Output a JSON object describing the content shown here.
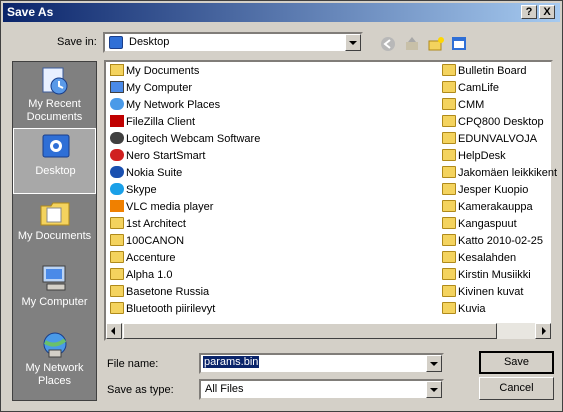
{
  "window": {
    "title": "Save As"
  },
  "title_buttons": {
    "help": "?",
    "close": "X"
  },
  "save_in": {
    "label": "Save in:",
    "value": "Desktop"
  },
  "places": [
    {
      "label": "My Recent Documents",
      "icon": "recent-documents-icon"
    },
    {
      "label": "Desktop",
      "icon": "desktop-icon"
    },
    {
      "label": "My Documents",
      "icon": "my-documents-icon"
    },
    {
      "label": "My Computer",
      "icon": "my-computer-icon"
    },
    {
      "label": "My Network Places",
      "icon": "network-places-icon"
    }
  ],
  "files_col1": [
    "My Documents",
    "My Computer",
    "My Network Places",
    "FileZilla Client",
    "Logitech Webcam Software",
    "Nero StartSmart",
    "Nokia Suite",
    "Skype",
    "VLC media player",
    "1st Architect",
    "100CANON",
    "Accenture",
    "Alpha 1.0",
    "Basetone Russia",
    "Bluetooth piirilevyt"
  ],
  "files_col2": [
    "Bulletin Board",
    "CamLife",
    "CMM",
    "CPQ800 Desktop",
    "EDUNVALVOJA",
    "HelpDesk",
    "Jakomäen leikkikent",
    "Jesper Kuopio",
    "Kamerakauppa",
    "Kangaspuut",
    "Katto 2010-02-25",
    "Kesalahden",
    "Kirstin Musiikki",
    "Kivinen kuvat",
    "Kuvia"
  ],
  "file_name": {
    "label": "File name:",
    "value": "params.bin"
  },
  "save_as_type": {
    "label": "Save as type:",
    "value": "All Files"
  },
  "buttons": {
    "save": "Save",
    "cancel": "Cancel"
  },
  "colors": {
    "titlebar": "#0a246a",
    "face": "#d4d0c8",
    "selection": "#0a246a"
  }
}
